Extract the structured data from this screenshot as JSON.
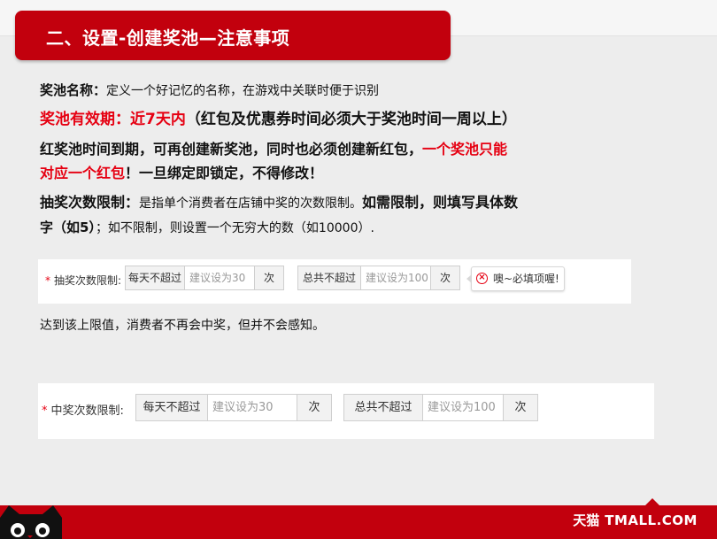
{
  "header": {
    "title": "二、设置-创建奖池—注意事项"
  },
  "text": {
    "l1_label": "奖池名称：",
    "l1_rest": "定义一个好记忆的名称，在游戏中关联时便于识别",
    "l2_red": "奖池有效期：近7天内",
    "l2_black": "（红包及优惠券时间必须大于奖池时间一周以上）",
    "l3_black": "红奖池时间到期，可再创建新奖池，同时也必须创建新红包，",
    "l3_red": "一个奖池只能",
    "l4_red": "对应一个红包",
    "l4_black": "！一旦绑定即锁定，不得修改！",
    "l5_label": "抽奖次数限制：",
    "l5_rest": "是指单个消费者在店铺中奖的次数限制。",
    "l5_bold": "如需限制，则填写具体数",
    "l6_bold": "字（如5）",
    "l6_rest": "；如不限制，则设置一个无穷大的数（如10000）.",
    "l8": "达到该上限值，消费者不再会中奖，但并不会感知。"
  },
  "form1": {
    "label": "抽奖次数限制:",
    "daily_label": "每天不超过",
    "daily_placeholder": "建议设为30",
    "unit1": "次",
    "total_label": "总共不超过",
    "total_placeholder": "建议设为100",
    "unit2": "次",
    "error": "噢~必填项喔!"
  },
  "form2": {
    "label": "中奖次数限制:",
    "daily_label": "每天不超过",
    "daily_placeholder": "建议设为30",
    "unit1": "次",
    "total_label": "总共不超过",
    "total_placeholder": "建议设为100",
    "unit2": "次"
  },
  "footer": {
    "brand_cn": "天猫",
    "brand_en": "TMALL.COM"
  },
  "colors": {
    "brand_red": "#c2000d",
    "text_red": "#e60012"
  }
}
